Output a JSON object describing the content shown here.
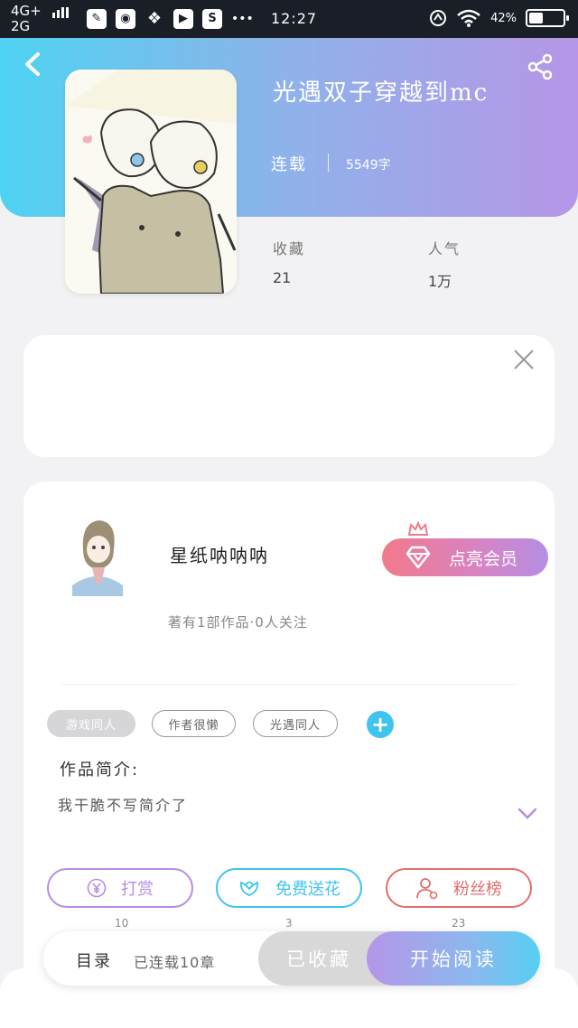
{
  "status_bar": {
    "network_top": "4G+",
    "network_bottom": "2G",
    "more": "•••",
    "time": "12:27",
    "battery": "42%",
    "battery_level": 0.42,
    "apps": [
      "paint-app-icon",
      "browser-app-icon",
      "wechat-icon",
      "video-icon",
      "s-app-icon"
    ]
  },
  "header": {
    "title": "光遇双子穿越到mc",
    "status": "连载",
    "word_count": "5549字",
    "gradient": [
      "#4fd3f2",
      "#b696e8"
    ]
  },
  "stats": [
    {
      "label": "收藏",
      "value": "21"
    },
    {
      "label": "人气",
      "value": "1万"
    }
  ],
  "author": {
    "name": "星纸呐呐呐",
    "meta": "著有1部作品·0人关注",
    "vip_label": "点亮会员"
  },
  "tags": [
    "游戏同人",
    "作者很懒",
    "光遇同人"
  ],
  "intro": {
    "title": "作品简介:",
    "text": "我干脆不写简介了"
  },
  "actions": [
    {
      "label": "打赏",
      "count": "10",
      "icon": "yen-icon",
      "color": "#b58ee3"
    },
    {
      "label": "免费送花",
      "count": "3",
      "icon": "flower-icon",
      "color": "#3fc4ee"
    },
    {
      "label": "粉丝榜",
      "count": "23",
      "icon": "user-rank-icon",
      "color": "#e06e6e"
    }
  ],
  "bottom_bar": {
    "toc_label": "目录",
    "progress": "已连载10章",
    "favorited_label": "已收藏",
    "read_label": "开始阅读"
  }
}
